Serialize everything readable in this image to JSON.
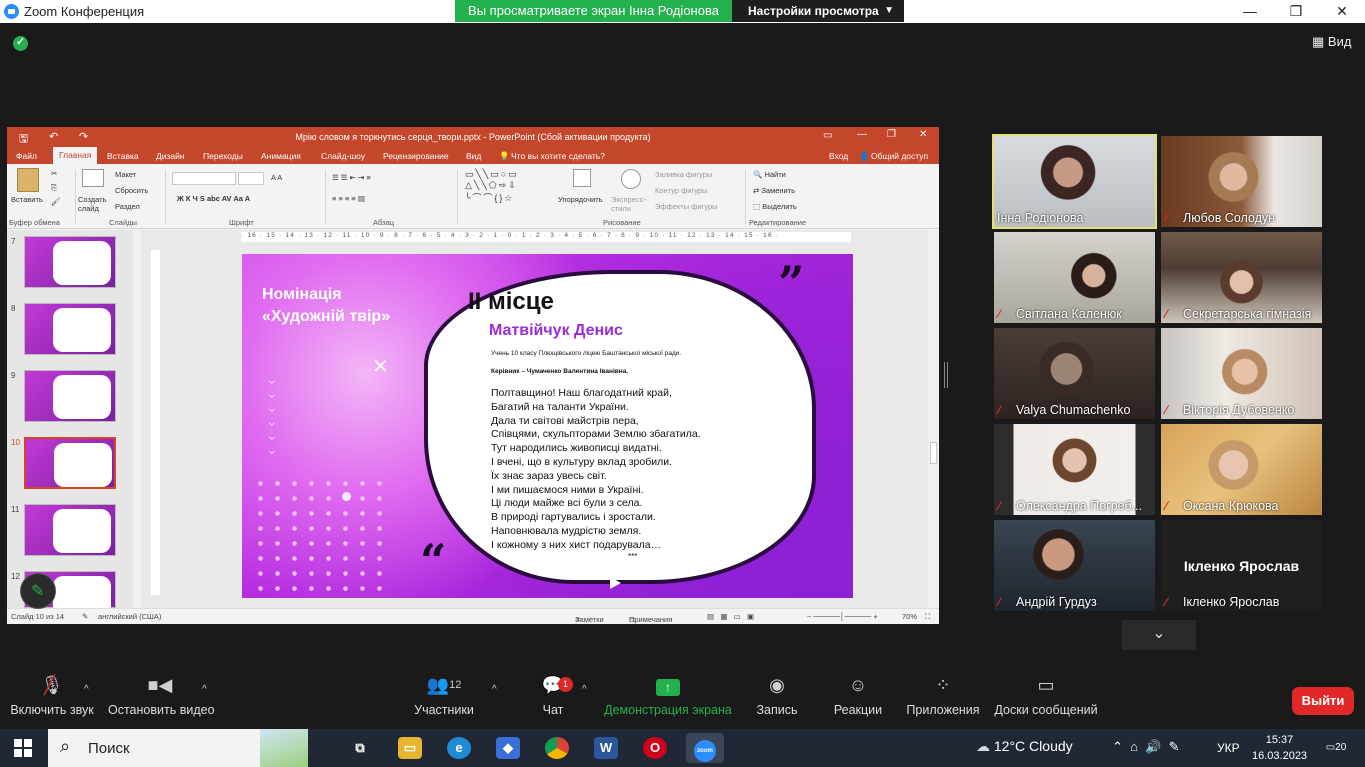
{
  "zoom": {
    "app_title": "Zoom Конференция",
    "share_banner": "Вы просматриваете экран Інна Родіонова",
    "view_settings": "Настройки просмотра",
    "view_button": "Вид",
    "window_buttons": [
      "—",
      "❐",
      "✕"
    ]
  },
  "ppt": {
    "window_title": "Мрію словом я торкнутись серця_твори.pptx - PowerPoint (Сбой активации продукта)",
    "tabs": [
      "Файл",
      "Главная",
      "Вставка",
      "Дизайн",
      "Переходы",
      "Анимация",
      "Слайд-шоу",
      "Рецензирование",
      "Вид"
    ],
    "tell_me": "Что вы хотите сделать?",
    "signin": "Вход",
    "share": "Общий доступ",
    "ribbon": {
      "paste": "Вставить",
      "create_slide": "Создать слайд",
      "layout": "Макет",
      "reset": "Сбросить",
      "section": "Раздел",
      "arrange": "Упорядочить",
      "express_styles": "Экспресс-стили",
      "fill": "Заливка фигуры",
      "outline": "Контур фигуры",
      "effects": "Эффекты фигуры",
      "find": "Найти",
      "replace": "Заменить",
      "select": "Выделить",
      "groups": [
        "Буфер обмена",
        "Слайды",
        "Шрифт",
        "Абзац",
        "Рисование",
        "Редактирование"
      ]
    },
    "ruler_h": "· 16 · 15 · 14 · 13 · 12 · 11 · 10 · 9 · 8 · 7 · 6 · 5 · 4 · 3 · 2 · 1 · 0 · 1 · 2 · 3 · 4 · 5 · 6 · 7 · 8 · 9 · 10 · 11 · 12 · 13 · 14 · 15 · 16 ·",
    "thumbnails": [
      "7",
      "8",
      "9",
      "10",
      "11",
      "12"
    ],
    "selected_thumbnail": "10",
    "slide": {
      "nomination_line1": "Номінація",
      "nomination_line2": "«Художній твір»",
      "place": "II місце",
      "name": "Матвійчук Денис",
      "student": "Учень 10 класу Плющівського ліцею Баштанської міської ради.",
      "supervisor": "Керівник – Чумаченко Валентина Іванівна.",
      "poem": [
        "Полтавщино! Наш благодатний край,",
        "Багатий на таланти України.",
        "Дала ти світові майстрів пера,",
        "Співцями, скульпторами Землю збагатила.",
        "Тут народились живописці видатні.",
        "І вчені, що в культуру вклад зробили.",
        "Їх знає зараз увесь світ.",
        "І ми пишаємося ними в Україні.",
        "Ці люди майже всі були з села.",
        "В природі гартувались і зростали.",
        "Наповнювала мудрістю земля.",
        "І кожному з них хист подарувала…"
      ],
      "stars": "***"
    },
    "status": {
      "slide_count": "Слайд 10 из 14",
      "language": "английский (США)",
      "notes": "Заметки",
      "comments": "Примечания",
      "zoom": "70%"
    }
  },
  "participants": [
    {
      "name": "Інна Родіонова",
      "muted": false,
      "active": true
    },
    {
      "name": "Любов Солодун",
      "muted": true
    },
    {
      "name": "Світлана Каленюк",
      "muted": true
    },
    {
      "name": "Секретарська гімназія",
      "muted": true
    },
    {
      "name": "Valya Chumachenko",
      "muted": true
    },
    {
      "name": "Вікторія Дубовенко",
      "muted": true
    },
    {
      "name": "Олександра Погреб...",
      "muted": true
    },
    {
      "name": "Оксана Крюкова",
      "muted": true
    },
    {
      "name": "Андрій Гурдуз",
      "muted": true
    },
    {
      "name": "Ікленко Ярослав",
      "muted": true,
      "video_off": true
    }
  ],
  "toolbar": {
    "mute": "Включить звук",
    "video": "Остановить видео",
    "participants": "Участники",
    "participants_count": "12",
    "chat": "Чат",
    "chat_badge": "1",
    "share": "Демонстрация экрана",
    "record": "Запись",
    "reactions": "Реакции",
    "apps": "Приложения",
    "whiteboards": "Доски сообщений",
    "leave": "Выйти"
  },
  "taskbar": {
    "search": "Поиск",
    "weather": "12°C  Cloudy",
    "lang": "УКР",
    "time": "15:37",
    "date": "16.03.2023",
    "notifications": "20"
  },
  "colors": {
    "zoom_green": "#23b14d",
    "ppt_red": "#c5472b",
    "leave_red": "#e02828",
    "slide_purple": "#b42be0"
  }
}
